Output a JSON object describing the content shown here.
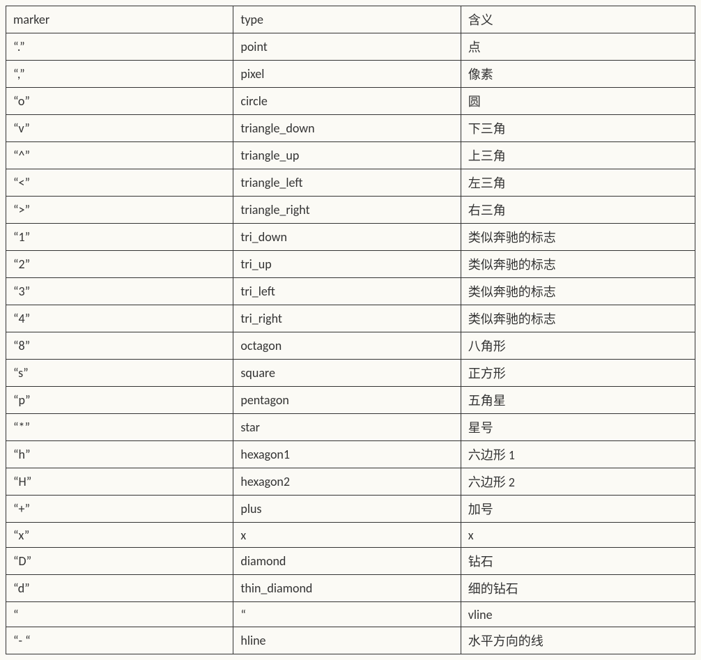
{
  "table": {
    "headers": [
      "marker",
      "type",
      "含义"
    ],
    "rows": [
      {
        "marker": "“.”",
        "type": "point",
        "meaning": "点"
      },
      {
        "marker": "“,”",
        "type": "pixel",
        "meaning": "像素"
      },
      {
        "marker": "“o”",
        "type": "circle",
        "meaning": "圆"
      },
      {
        "marker": "“v”",
        "type": "triangle_down",
        "meaning": "下三角"
      },
      {
        "marker": "“^”",
        "type": "triangle_up",
        "meaning": "上三角"
      },
      {
        "marker": "“<”",
        "type": "triangle_left",
        "meaning": "左三角"
      },
      {
        "marker": "“>”",
        "type": "triangle_right",
        "meaning": "右三角"
      },
      {
        "marker": "“1”",
        "type": "tri_down",
        "meaning": "类似奔驰的标志"
      },
      {
        "marker": "“2”",
        "type": "tri_up",
        "meaning": "类似奔驰的标志"
      },
      {
        "marker": "“3”",
        "type": "tri_left",
        "meaning": "类似奔驰的标志"
      },
      {
        "marker": "“4”",
        "type": "tri_right",
        "meaning": "类似奔驰的标志"
      },
      {
        "marker": "“8”",
        "type": "octagon",
        "meaning": "八角形"
      },
      {
        "marker": "“s”",
        "type": "square",
        "meaning": "正方形"
      },
      {
        "marker": "“p”",
        "type": "pentagon",
        "meaning": "五角星"
      },
      {
        "marker": "“*”",
        "type": "star",
        "meaning": "星号"
      },
      {
        "marker": "“h”",
        "type": "hexagon1",
        "meaning": "六边形 1"
      },
      {
        "marker": "“H”",
        "type": "hexagon2",
        "meaning": "六边形 2"
      },
      {
        "marker": "“+”",
        "type": "plus",
        "meaning": "加号"
      },
      {
        "marker": "“x”",
        "type": "x",
        "meaning": "x"
      },
      {
        "marker": "“D”",
        "type": "diamond",
        "meaning": "钻石"
      },
      {
        "marker": "“d”",
        "type": "thin_diamond",
        "meaning": "细的钻石"
      },
      {
        "marker": "“",
        "type": "“",
        "meaning": "vline"
      },
      {
        "marker": "“- “",
        "type": "hline",
        "meaning": "水平方向的线"
      }
    ]
  }
}
